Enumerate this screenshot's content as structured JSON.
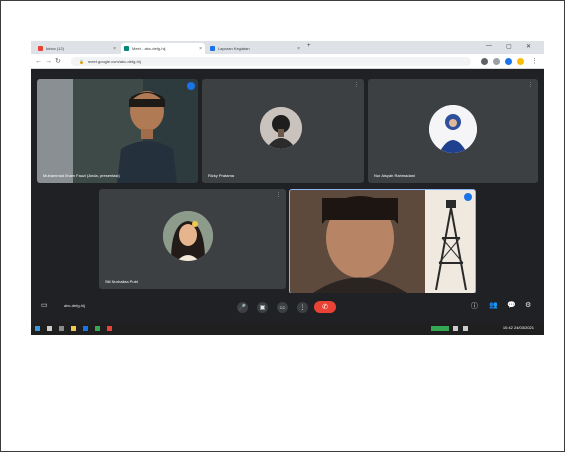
{
  "browser": {
    "tabs": [
      {
        "label": "Inbox (12)",
        "active": false,
        "favicon_color": "#ea4335"
      },
      {
        "label": "Meet - abc-defg-hij",
        "active": true,
        "favicon_color": "#00897b"
      },
      {
        "label": "Laporan Kegiatan",
        "active": false,
        "favicon_color": "#1a73e8"
      }
    ],
    "new_tab": "+",
    "url": "meet.google.com/abc-defg-hij",
    "window_controls": [
      "—",
      "▢",
      "✕"
    ]
  },
  "meet": {
    "participants": [
      {
        "name": "Muhammad Ilham Fauzi (Anda, presentasi)",
        "type": "video",
        "speaking": true
      },
      {
        "name": "Rizky Pratama",
        "type": "avatar",
        "avatar_bg": "#d7ccc8"
      },
      {
        "name": "Nur Aisyah Rahmadani",
        "type": "avatar",
        "avatar_bg": "#e8eaf6"
      },
      {
        "name": "Siti Nurhaliza Putri",
        "type": "avatar",
        "avatar_bg": "#9e9e9e"
      },
      {
        "name": "Dimas Aditya",
        "type": "video",
        "speaking": true
      }
    ],
    "meeting_code": "abc-defg-hij",
    "controls": {
      "mic": "🎤",
      "cam": "▣",
      "cc": "CC",
      "present": "⇪",
      "more": "⋮",
      "leave": "✆"
    },
    "right_controls": [
      "ⓘ",
      "👥",
      "💬",
      "⚙"
    ]
  },
  "taskbar": {
    "time": "10:42",
    "date": "24/03/2021"
  },
  "colors": {
    "meet_bg": "#202124",
    "tile_bg": "#3c4043",
    "leave": "#ea4335",
    "accent": "#1a73e8"
  }
}
